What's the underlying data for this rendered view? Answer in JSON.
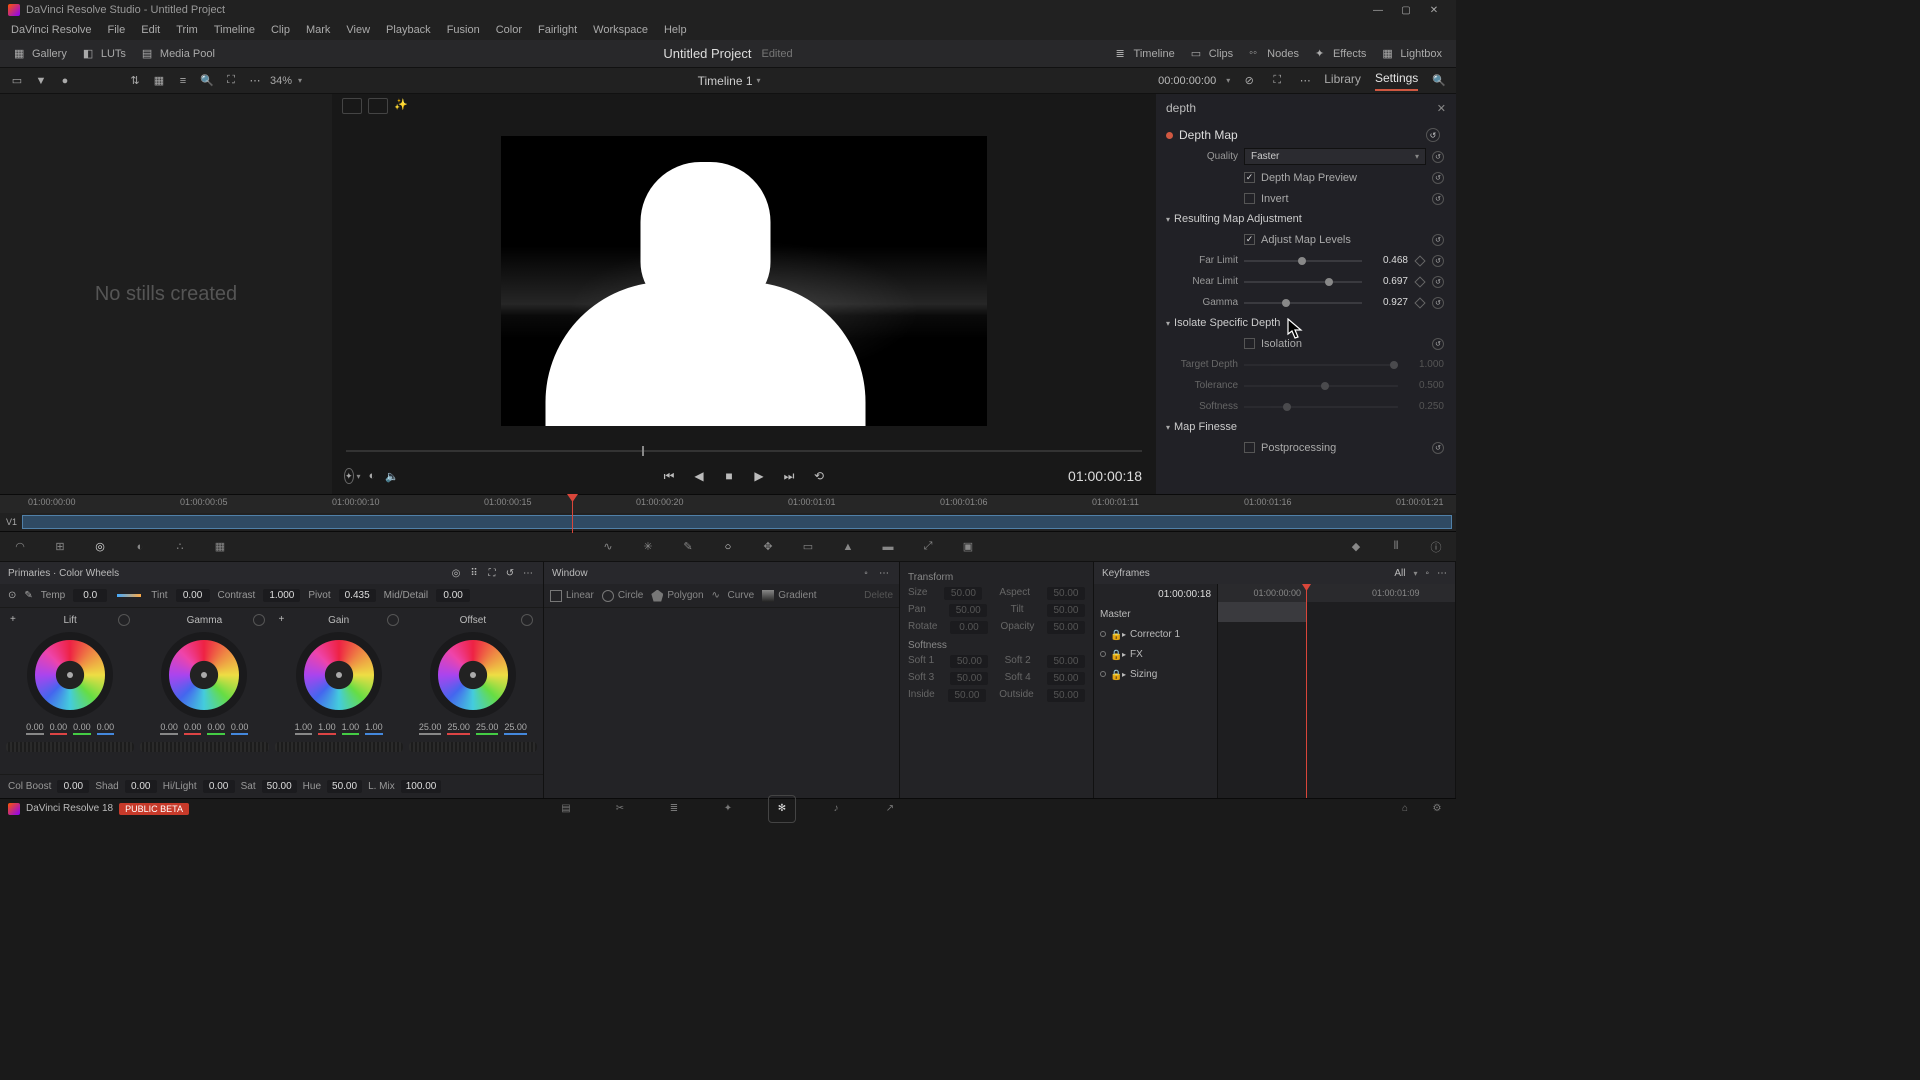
{
  "titlebar": {
    "text": "DaVinci Resolve Studio - Untitled Project"
  },
  "menu": [
    "DaVinci Resolve",
    "File",
    "Edit",
    "Trim",
    "Timeline",
    "Clip",
    "Mark",
    "View",
    "Playback",
    "Fusion",
    "Color",
    "Fairlight",
    "Workspace",
    "Help"
  ],
  "toolbar": {
    "gallery": "Gallery",
    "luts": "LUTs",
    "mediapool": "Media Pool",
    "project": "Untitled Project",
    "edited": "Edited",
    "timeline": "Timeline",
    "clips": "Clips",
    "nodes": "Nodes",
    "effects": "Effects",
    "lightbox": "Lightbox"
  },
  "subtool": {
    "zoom": "34%",
    "timeline_name": "Timeline 1",
    "tc": "00:00:00:00"
  },
  "gallery_empty": "No stills created",
  "transport": {
    "tc": "01:00:00:18"
  },
  "inspector": {
    "tabs": {
      "library": "Library",
      "settings": "Settings"
    },
    "search": "depth",
    "title": "Depth Map",
    "quality_label": "Quality",
    "quality_value": "Faster",
    "preview_label": "Depth Map Preview",
    "invert_label": "Invert",
    "sec_map": "Resulting Map Adjustment",
    "adjust_label": "Adjust Map Levels",
    "far_label": "Far Limit",
    "far_val": "0.468",
    "near_label": "Near Limit",
    "near_val": "0.697",
    "gamma_label": "Gamma",
    "gamma_val": "0.927",
    "sec_iso": "Isolate Specific Depth",
    "iso_label": "Isolation",
    "target_label": "Target Depth",
    "target_val": "1.000",
    "tol_label": "Tolerance",
    "tol_val": "0.500",
    "soft_label": "Softness",
    "soft_val": "0.250",
    "sec_fin": "Map Finesse",
    "post_label": "Postprocessing"
  },
  "timeline_ticks": [
    "01:00:00:00",
    "01:00:00:05",
    "01:00:00:10",
    "01:00:00:15",
    "01:00:00:20",
    "01:00:01:01",
    "01:00:01:06",
    "01:00:01:11",
    "01:00:01:16",
    "01:00:01:21"
  ],
  "track_label": "V1",
  "primaries": {
    "title": "Primaries · Color Wheels",
    "temp_l": "Temp",
    "temp_v": "0.0",
    "tint_l": "Tint",
    "tint_v": "0.00",
    "contrast_l": "Contrast",
    "contrast_v": "1.000",
    "pivot_l": "Pivot",
    "pivot_v": "0.435",
    "md_l": "Mid/Detail",
    "md_v": "0.00",
    "wheels": {
      "lift": {
        "name": "Lift",
        "vals": [
          "0.00",
          "0.00",
          "0.00",
          "0.00"
        ]
      },
      "gamma": {
        "name": "Gamma",
        "vals": [
          "0.00",
          "0.00",
          "0.00",
          "0.00"
        ]
      },
      "gain": {
        "name": "Gain",
        "vals": [
          "1.00",
          "1.00",
          "1.00",
          "1.00"
        ]
      },
      "offset": {
        "name": "Offset",
        "vals": [
          "25.00",
          "25.00",
          "25.00",
          "25.00"
        ]
      }
    },
    "bottom": {
      "cb_l": "Col Boost",
      "cb_v": "0.00",
      "shad_l": "Shad",
      "shad_v": "0.00",
      "hl_l": "Hi/Light",
      "hl_v": "0.00",
      "sat_l": "Sat",
      "sat_v": "50.00",
      "hue_l": "Hue",
      "hue_v": "50.00",
      "lmix_l": "L. Mix",
      "lmix_v": "100.00"
    }
  },
  "window_panel": {
    "title": "Window",
    "shapes": {
      "linear": "Linear",
      "circle": "Circle",
      "polygon": "Polygon",
      "curve": "Curve",
      "gradient": "Gradient",
      "delete": "Delete"
    }
  },
  "xform": {
    "title": "Transform",
    "size_l": "Size",
    "size_v": "50.00",
    "aspect_l": "Aspect",
    "aspect_v": "50.00",
    "pan_l": "Pan",
    "pan_v": "50.00",
    "tilt_l": "Tilt",
    "tilt_v": "50.00",
    "rot_l": "Rotate",
    "rot_v": "0.00",
    "op_l": "Opacity",
    "op_v": "50.00",
    "soft_title": "Softness",
    "s1_l": "Soft 1",
    "s1_v": "50.00",
    "s2_l": "Soft 2",
    "s2_v": "50.00",
    "s3_l": "Soft 3",
    "s3_v": "50.00",
    "s4_l": "Soft 4",
    "s4_v": "50.00",
    "in_l": "Inside",
    "in_v": "50.00",
    "out_l": "Outside",
    "out_v": "50.00"
  },
  "keyframes": {
    "title": "Keyframes",
    "all": "All",
    "tc": "01:00:00:18",
    "t1": "01:00:00:00",
    "t2": "01:00:01:09",
    "rows": [
      "Master",
      "Corrector 1",
      "FX",
      "Sizing"
    ]
  },
  "footer": {
    "app": "DaVinci Resolve 18",
    "beta": "PUBLIC BETA"
  }
}
